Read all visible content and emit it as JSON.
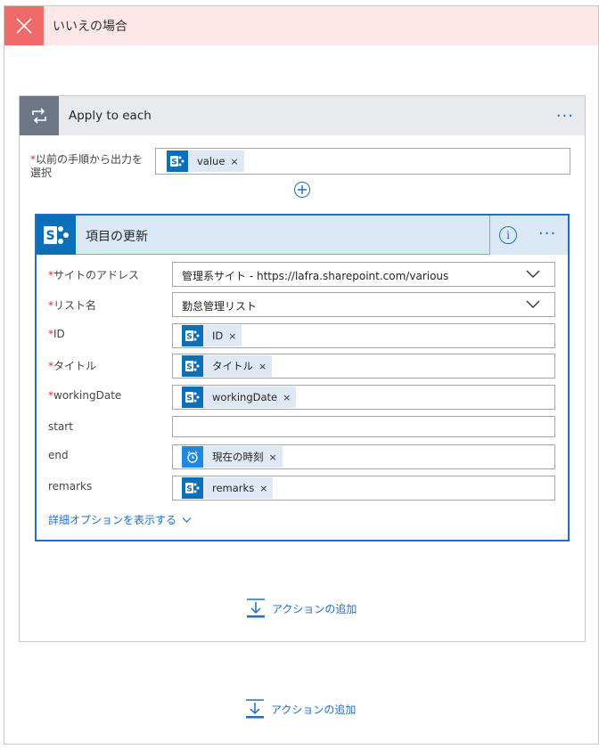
{
  "condition": {
    "title": "いいえの場合",
    "icon": "close-icon",
    "color": "#f06a6a"
  },
  "apply_each": {
    "title": "Apply to each",
    "icon": "loop-icon",
    "more": "···",
    "select_label": "以前の手順から出力を選択",
    "select_required": "*",
    "select_token": "value"
  },
  "update_item": {
    "title": "項目の更新",
    "icon": "sharepoint-icon",
    "info": "i",
    "more": "···",
    "fields": [
      {
        "label": "サイトのアドレス",
        "required": "*",
        "type": "dropdown",
        "value": "管理系サイト - https://lafra.sharepoint.com/various"
      },
      {
        "label": "リスト名",
        "required": "*",
        "type": "dropdown",
        "value": "勤怠管理リスト"
      },
      {
        "label": "ID",
        "required": "*",
        "type": "token",
        "token": "ID",
        "token_icon": "sharepoint-icon"
      },
      {
        "label": "タイトル",
        "required": "*",
        "type": "token",
        "token": "タイトル",
        "token_icon": "sharepoint-icon"
      },
      {
        "label": "workingDate",
        "required": "*",
        "type": "token",
        "token": "workingDate",
        "token_icon": "sharepoint-icon"
      },
      {
        "label": "start",
        "required": "",
        "type": "text",
        "value": ""
      },
      {
        "label": "end",
        "required": "",
        "type": "token",
        "token": "現在の時刻",
        "token_icon": "clock-icon"
      },
      {
        "label": "remarks",
        "required": "",
        "type": "token",
        "token": "remarks",
        "token_icon": "sharepoint-icon"
      }
    ],
    "advanced_link": "詳細オプションを表示する"
  },
  "add_action_inner": "アクションの追加",
  "add_action_outer": "アクションの追加",
  "colors": {
    "accent": "#1f6fc5",
    "sharepoint": "#0b6fb9",
    "token_bg": "#dfe9f6",
    "clock": "#1e88e5"
  }
}
